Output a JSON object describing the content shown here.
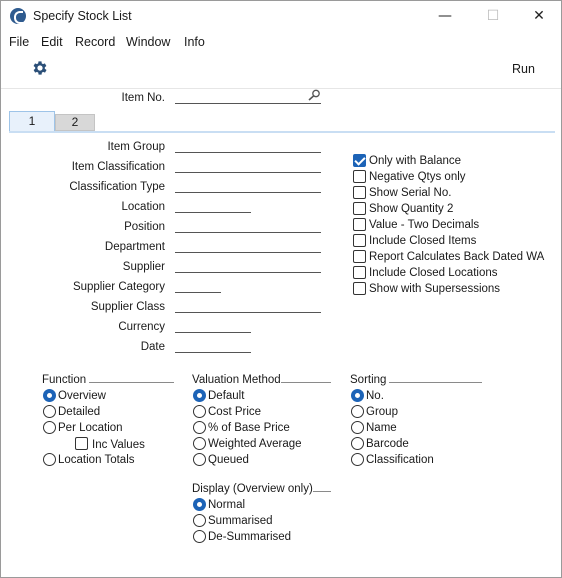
{
  "window": {
    "title": "Specify Stock List",
    "minimize": "—",
    "maximize": "☐",
    "close": "✕"
  },
  "menu": [
    "File",
    "Edit",
    "Record",
    "Window",
    "Info"
  ],
  "toolbar": {
    "run_label": "Run",
    "settings_icon": "gear-icon"
  },
  "item_no": {
    "label": "Item No.",
    "value": ""
  },
  "tabs": [
    "1",
    "2"
  ],
  "fields": [
    {
      "label": "Item Group",
      "value": ""
    },
    {
      "label": "Item Classification",
      "value": ""
    },
    {
      "label": "Classification Type",
      "value": ""
    },
    {
      "label": "Location",
      "value": ""
    },
    {
      "label": "Position",
      "value": ""
    },
    {
      "label": "Department",
      "value": ""
    },
    {
      "label": "Supplier",
      "value": ""
    },
    {
      "label": "Supplier Category",
      "value": ""
    },
    {
      "label": "Supplier Class",
      "value": ""
    },
    {
      "label": "Currency",
      "value": ""
    },
    {
      "label": "Date",
      "value": ""
    }
  ],
  "checkboxes": [
    {
      "label": "Only with Balance",
      "checked": true
    },
    {
      "label": "Negative Qtys only",
      "checked": false
    },
    {
      "label": "Show Serial No.",
      "checked": false
    },
    {
      "label": "Show Quantity 2",
      "checked": false
    },
    {
      "label": "Value - Two Decimals",
      "checked": false
    },
    {
      "label": "Include Closed Items",
      "checked": false
    },
    {
      "label": "Report Calculates Back Dated WA",
      "checked": false
    },
    {
      "label": "Include Closed Locations",
      "checked": false
    },
    {
      "label": "Show with Supersessions",
      "checked": false
    }
  ],
  "function": {
    "title": "Function",
    "options": [
      "Overview",
      "Detailed",
      "Per Location",
      "Location Totals"
    ],
    "selected": "Overview",
    "inc_values": {
      "label": "Inc Values",
      "checked": false
    }
  },
  "valuation": {
    "title": "Valuation Method",
    "options": [
      "Default",
      "Cost Price",
      "% of Base Price",
      "Weighted Average",
      "Queued"
    ],
    "selected": "Default"
  },
  "sorting": {
    "title": "Sorting",
    "options": [
      "No.",
      "Group",
      "Name",
      "Barcode",
      "Classification"
    ],
    "selected": "No."
  },
  "display": {
    "title": "Display (Overview only)",
    "options": [
      "Normal",
      "Summarised",
      "De-Summarised"
    ],
    "selected": "Normal"
  },
  "colors": {
    "accent": "#1c63b7",
    "tab_active": "#e8f1fb",
    "tab_inactive": "#d8d8d8"
  }
}
